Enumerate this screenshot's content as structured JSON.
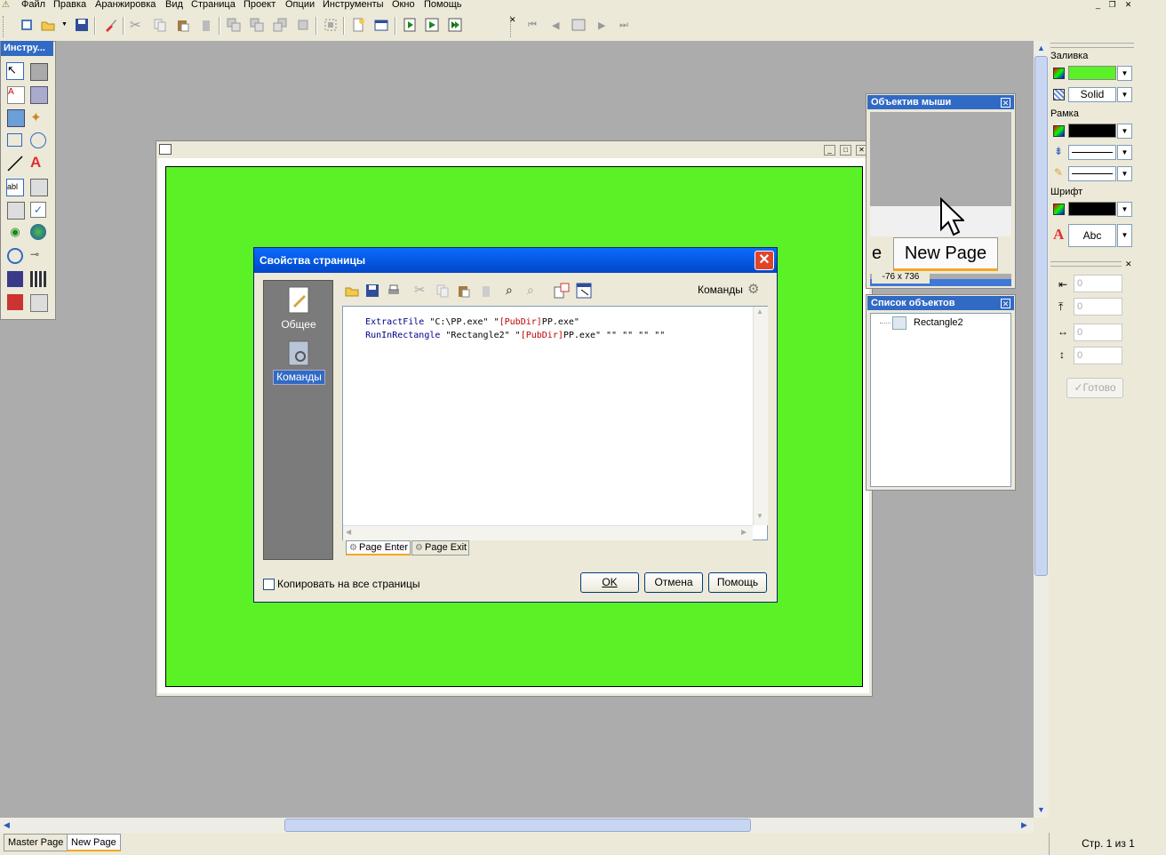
{
  "menubar": {
    "items": [
      "Файл",
      "Правка",
      "Аранжировка",
      "Вид",
      "Страница",
      "Проект",
      "Опции",
      "Инструменты",
      "Окно",
      "Помощь"
    ]
  },
  "tools_palette": {
    "title": "Инстру..."
  },
  "page_properties_dialog": {
    "title": "Свойства страницы",
    "sidebar": {
      "general_label": "Общее",
      "commands_label": "Команды"
    },
    "toolbar": {
      "commands_label": "Команды"
    },
    "script_lines": [
      [
        {
          "t": "ExtractFile",
          "c": "kw"
        },
        {
          "t": " \"C:\\PP.exe\" \"",
          "c": "str"
        },
        {
          "t": "[PubDir]",
          "c": "var"
        },
        {
          "t": "PP.exe\"",
          "c": "str"
        }
      ],
      [
        {
          "t": "RunInRectangle",
          "c": "kw"
        },
        {
          "t": " \"Rectangle2\" \"",
          "c": "str"
        },
        {
          "t": "[PubDir]",
          "c": "var"
        },
        {
          "t": "PP.exe\" \"\" \"\" \"\" \"\"",
          "c": "str"
        }
      ]
    ],
    "tabs": {
      "page_enter": "Page Enter",
      "page_exit": "Page Exit"
    },
    "copy_all_pages_label": "Копировать на все страницы",
    "ok_label": "OK",
    "cancel_label": "Отмена",
    "help_label": "Помощь"
  },
  "mouse_lens_panel": {
    "title": "Объектив мыши",
    "preview_text_fragment": "e",
    "preview_text": "New Page",
    "coords": "-76 x 736"
  },
  "object_list_panel": {
    "title": "Список объектов",
    "items": [
      "Rectangle2"
    ]
  },
  "properties_panel": {
    "fill_label": "Заливка",
    "fill_color": "#5af226",
    "fill_style": "Solid",
    "border_label": "Рамка",
    "border_color": "#000000",
    "font_label": "Шрифт",
    "font_color": "#000000",
    "font_sample": "Abc",
    "left_value": "0",
    "top_value": "0",
    "width_value": "0",
    "height_value": "0",
    "done_label": "Готово"
  },
  "page_tabs": [
    "Master Page",
    "New Page"
  ],
  "status": {
    "page_count": "Стр. 1 из 1"
  }
}
